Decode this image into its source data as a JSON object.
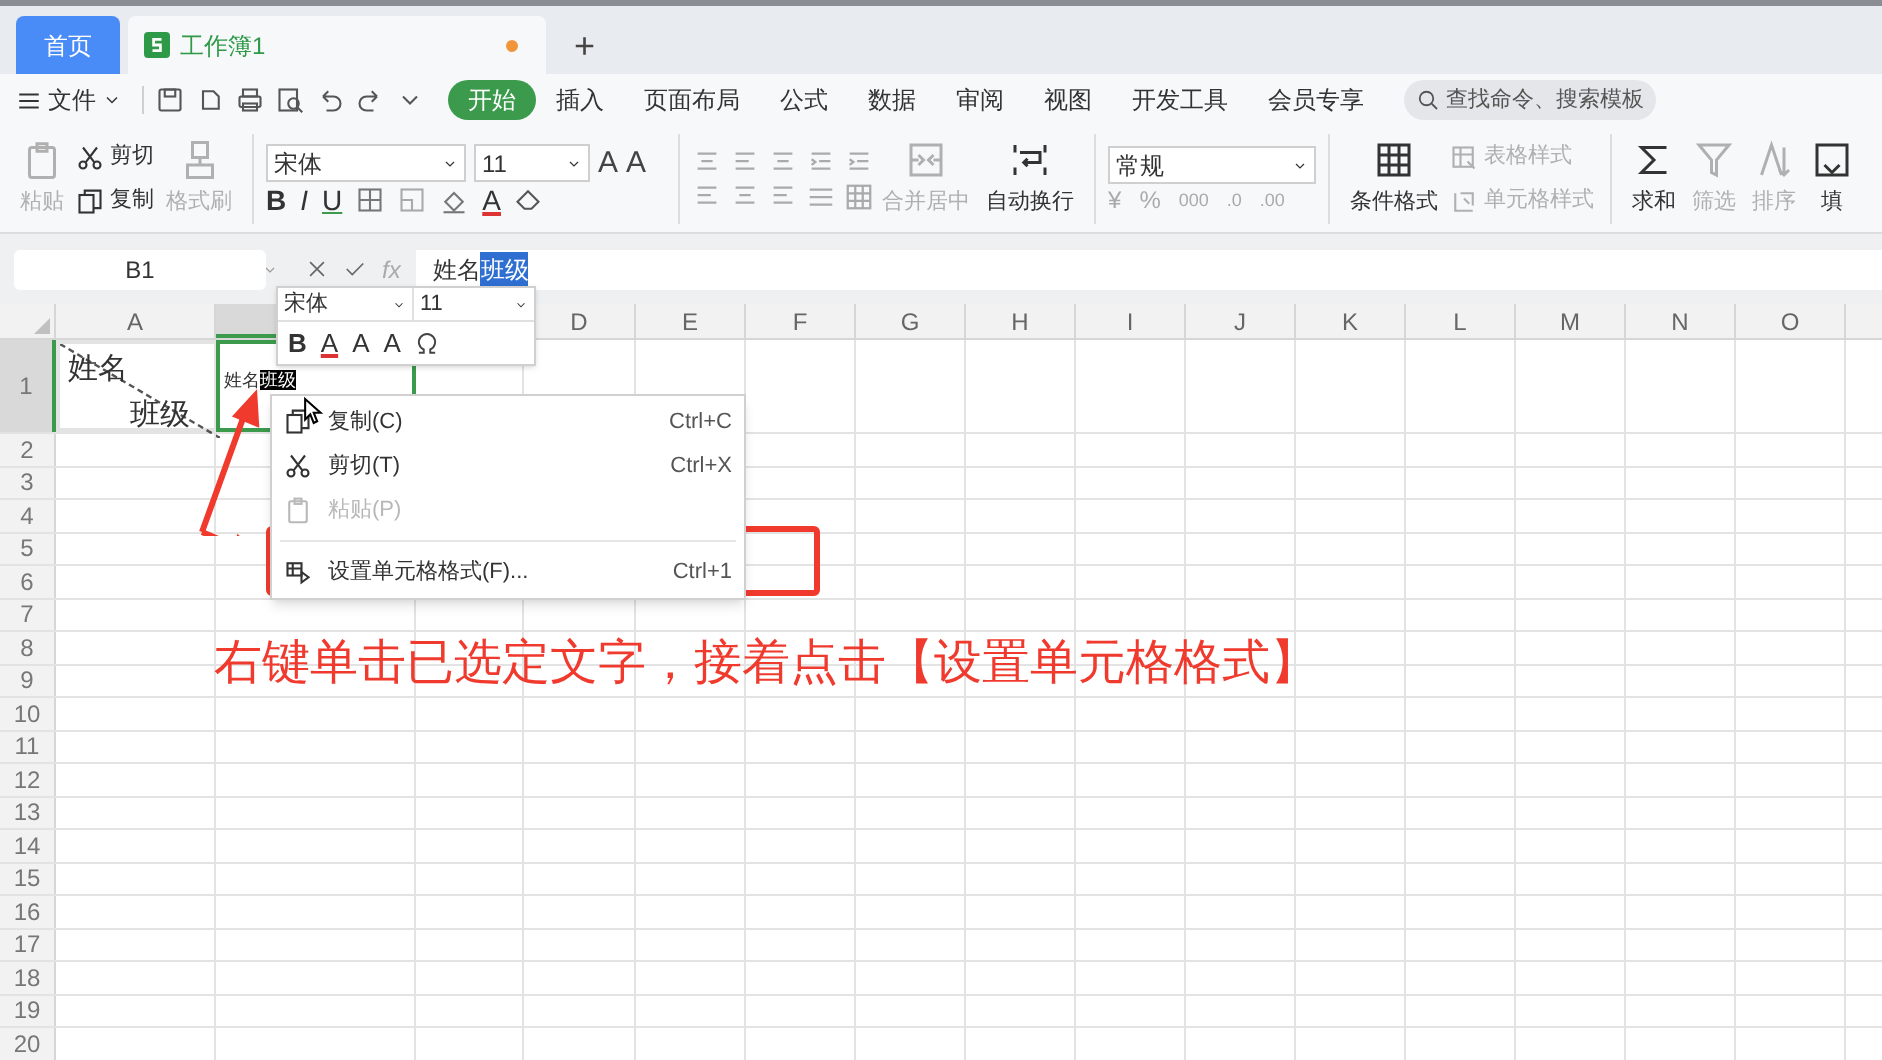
{
  "tabs": [
    {
      "kind": "home",
      "label": "首页",
      "selected": false
    },
    {
      "kind": "document",
      "label": "工作簿1",
      "selected": true,
      "unsaved": true
    }
  ],
  "new_tab_button": "+",
  "menu_bar": {
    "file_menu": "文件",
    "tabs": [
      {
        "label": "开始",
        "selected": true
      },
      {
        "label": "插入",
        "selected": false
      },
      {
        "label": "页面布局",
        "selected": false
      },
      {
        "label": "公式",
        "selected": false
      },
      {
        "label": "数据",
        "selected": false
      },
      {
        "label": "审阅",
        "selected": false
      },
      {
        "label": "视图",
        "selected": false
      },
      {
        "label": "开发工具",
        "selected": false
      },
      {
        "label": "会员专享",
        "selected": false
      }
    ],
    "search": {
      "placeholder": "查找命令、搜索模板"
    }
  },
  "ribbon": {
    "paste": {
      "label": "粘贴",
      "disabled": true
    },
    "cut": {
      "label": "剪切",
      "disabled": false
    },
    "copy": {
      "label": "复制",
      "disabled": false
    },
    "format_painter": {
      "label": "格式刷",
      "disabled": true
    },
    "font": "宋体",
    "font_size": "11",
    "grow_shrink": [
      "A",
      "A"
    ],
    "format_buttons": [
      "B",
      "I",
      "U"
    ],
    "font_color": "A",
    "merge": {
      "label": "合并居中",
      "disabled": true
    },
    "wrap": {
      "label": "自动换行",
      "disabled": false
    },
    "number_format": "常规",
    "number_buttons": [
      "¥",
      "%",
      "000",
      ".0",
      ".00"
    ],
    "conditional_format": {
      "label": "条件格式",
      "disabled": false
    },
    "table_style": {
      "label": "表格样式",
      "disabled": true
    },
    "cell_style": {
      "label": "单元格样式",
      "disabled": true
    },
    "sum": {
      "label": "求和",
      "disabled": false
    },
    "filter": {
      "label": "筛选",
      "disabled": true
    },
    "sort": {
      "label": "排序",
      "disabled": true
    },
    "fill": {
      "label": "填",
      "disabled": false
    }
  },
  "formula_bar": {
    "name_box": "B1",
    "function_label": "fx",
    "formula": [
      {
        "text": "姓名",
        "selected": false
      },
      {
        "text": "班级",
        "selected": true
      }
    ]
  },
  "sheet": {
    "columns": [
      {
        "label": "A",
        "selected": false
      },
      {
        "selected": true
      },
      {},
      {
        "label": "D",
        "selected": false
      },
      {
        "label": "E",
        "selected": false
      },
      {
        "label": "F",
        "selected": false
      },
      {
        "label": "G",
        "selected": false
      },
      {
        "label": "H",
        "selected": false
      },
      {
        "label": "I",
        "selected": false
      },
      {
        "label": "J",
        "selected": false
      },
      {
        "label": "K",
        "selected": false
      },
      {
        "label": "L",
        "selected": false
      },
      {
        "label": "M",
        "selected": false
      },
      {
        "label": "N",
        "selected": false
      },
      {
        "label": "O",
        "selected": false
      }
    ],
    "rows": [
      {
        "label": "1",
        "selected": true
      },
      {
        "label": "2",
        "selected": false
      },
      {
        "label": "3",
        "selected": false
      },
      {
        "label": "4",
        "selected": false
      },
      {
        "label": "5",
        "selected": false
      },
      {
        "label": "6",
        "selected": false
      },
      {
        "label": "7",
        "selected": false
      },
      {
        "label": "8",
        "selected": false
      },
      {
        "label": "9",
        "selected": false
      },
      {
        "label": "10",
        "selected": false
      },
      {
        "label": "11",
        "selected": false
      },
      {
        "label": "12",
        "selected": false
      },
      {
        "label": "13",
        "selected": false
      },
      {
        "label": "14",
        "selected": false
      },
      {
        "label": "15",
        "selected": false
      },
      {
        "label": "16",
        "selected": false
      },
      {
        "label": "17",
        "selected": false
      },
      {
        "label": "18",
        "selected": false
      },
      {
        "label": "19",
        "selected": false
      },
      {
        "label": "20",
        "selected": false
      }
    ],
    "a1": {
      "top": "姓名",
      "bottom": "班级"
    },
    "b1": [
      {
        "text": "姓名",
        "selected": false
      },
      {
        "text": "班级",
        "selected": true
      }
    ]
  },
  "mini_toolbar": {
    "font": "宋体",
    "size": "11",
    "buttons": [
      "B",
      "A",
      "A",
      "A"
    ]
  },
  "context_menu": {
    "items": [
      {
        "label": "复制(C)",
        "shortcut": "Ctrl+C",
        "disabled": false
      },
      {
        "label": "剪切(T)",
        "shortcut": "Ctrl+X",
        "disabled": false
      },
      {
        "label": "粘贴(P)",
        "disabled": true
      },
      {
        "label": "设置单元格格式(F)...",
        "shortcut": "Ctrl+1",
        "disabled": false
      }
    ]
  },
  "annotation": {
    "text": "右键单击已选定文字，接着点击【设置单元格格式】"
  }
}
